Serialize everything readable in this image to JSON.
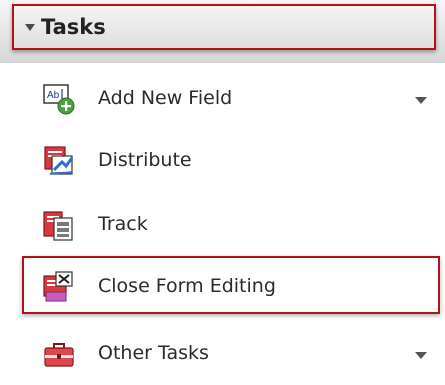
{
  "panel": {
    "title": "Tasks",
    "items": [
      {
        "label": "Add New Field",
        "icon": "add-field-icon",
        "has_dropdown": true
      },
      {
        "label": "Distribute",
        "icon": "distribute-icon",
        "has_dropdown": false
      },
      {
        "label": "Track",
        "icon": "track-icon",
        "has_dropdown": false
      },
      {
        "label": "Close Form Editing",
        "icon": "close-form-editing-icon",
        "has_dropdown": false
      },
      {
        "label": "Other Tasks",
        "icon": "briefcase-icon",
        "has_dropdown": true
      }
    ]
  },
  "colors": {
    "highlight": "#b3121a"
  }
}
